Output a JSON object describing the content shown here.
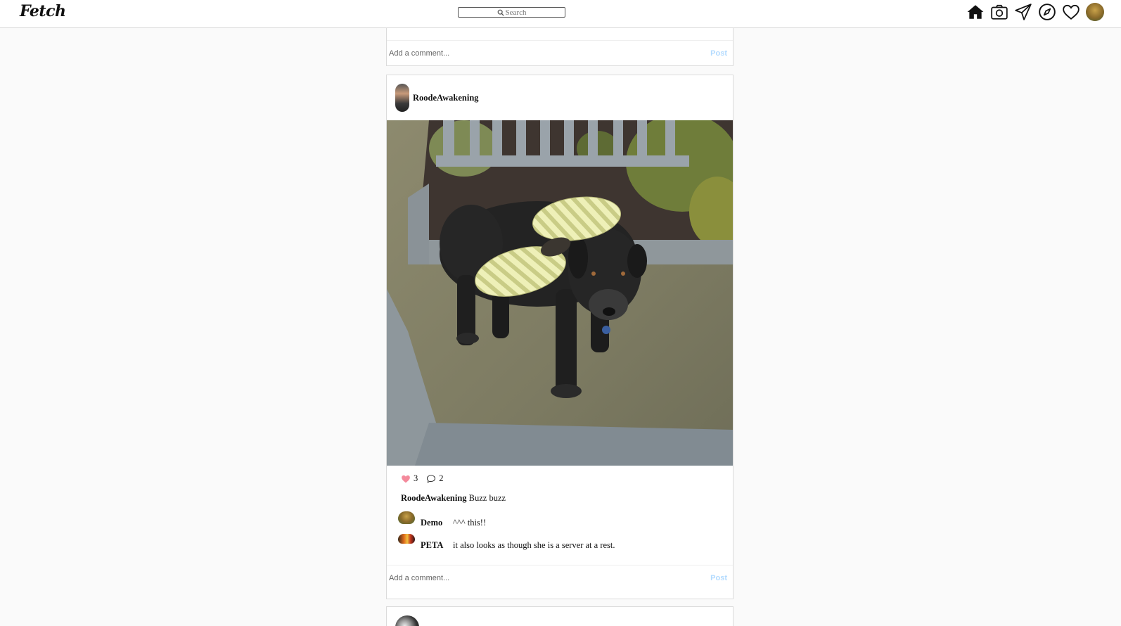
{
  "nav": {
    "logo": "Fetch",
    "search_placeholder": "Search",
    "icons": [
      "home-icon",
      "camera-icon",
      "paper-plane-icon",
      "compass-icon",
      "heart-icon",
      "profile-avatar"
    ]
  },
  "previous_post": {
    "comment_placeholder": "Add a comment...",
    "post_label": "Post"
  },
  "post": {
    "username": "RoodeAwakening",
    "likes": "3",
    "comments_count": "2",
    "caption_user": "RoodeAwakening",
    "caption_text": "Buzz buzz",
    "comments": [
      {
        "user": "Demo",
        "text": "^^^ this!!"
      },
      {
        "user": "PETA",
        "text": "it also looks as though she is a server at a rest."
      }
    ],
    "comment_placeholder": "Add a comment...",
    "post_label": "Post"
  },
  "colors": {
    "post_button": "#b3dbff",
    "heart_fill": "#f48a9c",
    "border": "#dbdbdb",
    "background": "#fafafa"
  }
}
